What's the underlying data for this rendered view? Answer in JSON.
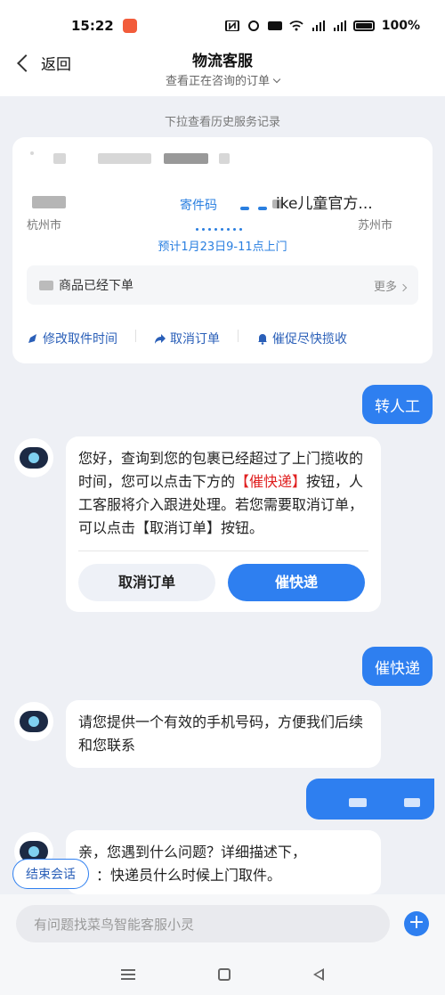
{
  "status_bar": {
    "time": "15:22",
    "battery": "100%"
  },
  "header": {
    "back_label": "返回",
    "title": "物流客服",
    "subtitle": "查看正在咨询的订单"
  },
  "history_hint": "下拉查看历史服务记录",
  "order_card": {
    "from_city": "杭州市",
    "pickup_code_label": "寄件码",
    "to_name": "ike儿童官方...",
    "to_city": "苏州市",
    "eta": "预计1月23日9-11点上门",
    "status": "商品已经下单",
    "more": "更多",
    "actions": [
      "修改取件时间",
      "取消订单",
      "催促尽快揽收"
    ]
  },
  "messages": {
    "user_1": "转人工",
    "bot_1_part1": "您好，查询到您的包裹已经超过了上门揽收的时间，您可以点击下方的",
    "bot_1_highlight": "【催快递】",
    "bot_1_part2": "按钮，人工客服将介入跟进处理。若您需要取消订单，可以点击【取消订单】按钮。",
    "bot_1_cancel_button": "取消订单",
    "bot_1_urge_button": "催快递",
    "user_2": "催快递",
    "bot_2": "请您提供一个有效的手机号码，方便我们后续和您联系",
    "bot_3_line1": "亲，您遇到什么问题？详细描述下，",
    "bot_3_line2": "：快递员什么时候上门取件。"
  },
  "end_chat": "结束会话",
  "input": {
    "placeholder": "有问题找菜鸟智能客服小灵"
  },
  "colors": {
    "primary": "#2e7ff0",
    "highlight": "#e02020"
  }
}
